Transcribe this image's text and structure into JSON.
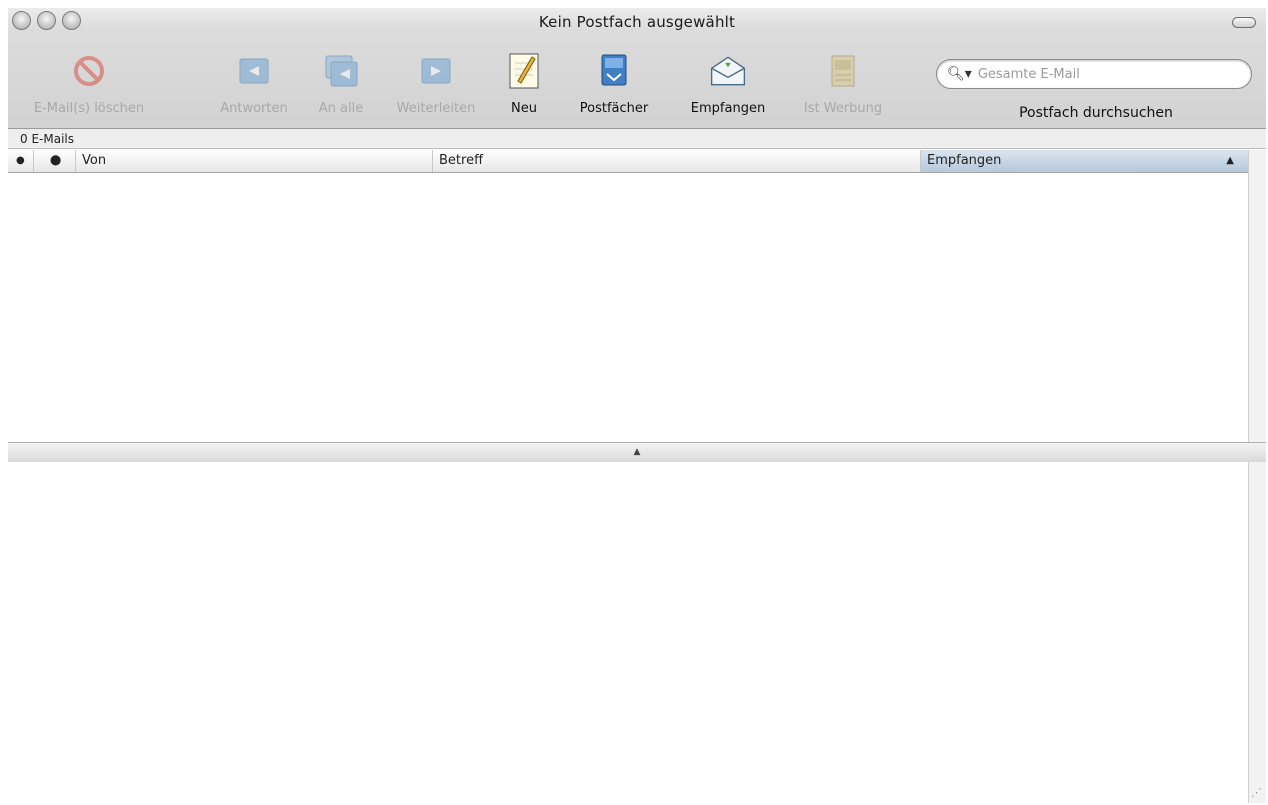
{
  "window": {
    "title": "Kein Postfach ausgewählt"
  },
  "toolbar": {
    "buttons": [
      {
        "label": "E-Mail(s) löschen",
        "icon": "delete-icon",
        "enabled": false
      },
      {
        "label": "Antworten",
        "icon": "reply-icon",
        "enabled": false
      },
      {
        "label": "An alle",
        "icon": "reply-all-icon",
        "enabled": false
      },
      {
        "label": "Weiterleiten",
        "icon": "forward-icon",
        "enabled": false
      },
      {
        "label": "Neu",
        "icon": "new-message-icon",
        "enabled": true
      },
      {
        "label": "Postfächer",
        "icon": "mailboxes-icon",
        "enabled": true
      },
      {
        "label": "Empfangen",
        "icon": "get-mail-icon",
        "enabled": true
      },
      {
        "label": "Ist Werbung",
        "icon": "junk-icon",
        "enabled": false
      }
    ],
    "search": {
      "placeholder": "Gesamte E-Mail",
      "label": "Postfach durchsuchen"
    }
  },
  "list": {
    "count_text": "0 E-Mails",
    "columns": {
      "unread": "●",
      "flag": "⬤",
      "from": "Von",
      "subject": "Betreff",
      "received": "Empfangen",
      "sort_arrow": "▲"
    },
    "rows": []
  },
  "splitter": {
    "glyph": "▲"
  },
  "colors": {
    "sorted_header": "#b7c9db",
    "disabled_text": "#a8a8a8"
  }
}
